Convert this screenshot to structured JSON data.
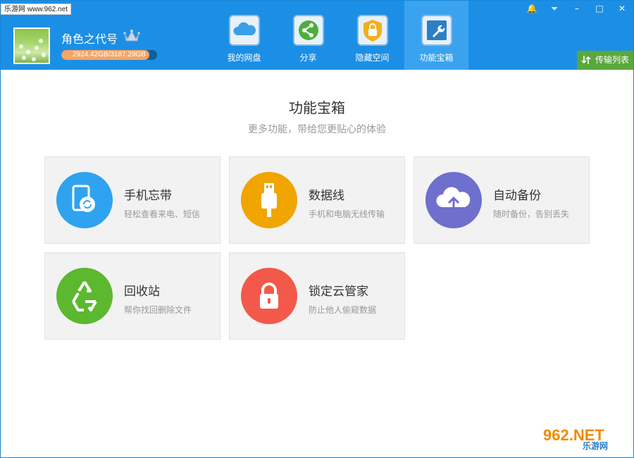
{
  "watermark_top": "乐游网 www.962.net",
  "user": {
    "name": "角色之代号",
    "quota": "2924.42GB/3187.29GB",
    "quota_used_fraction": 0.9175
  },
  "nav": [
    {
      "label": "我的网盘",
      "icon": "cloud-drive-icon",
      "active": false
    },
    {
      "label": "分享",
      "icon": "share-icon",
      "active": false
    },
    {
      "label": "隐藏空间",
      "icon": "lock-shield-icon",
      "active": false
    },
    {
      "label": "功能宝箱",
      "icon": "wrench-icon",
      "active": true
    }
  ],
  "window_controls": {
    "notify": "🔔",
    "menu": "⏷",
    "minimize": "–",
    "maximize": "□",
    "close": "✕"
  },
  "transfer_label": "传输列表",
  "page": {
    "title": "功能宝箱",
    "subtitle": "更多功能，带给您更贴心的体验"
  },
  "cards": [
    {
      "title": "手机忘带",
      "desc": "轻松查看来电、短信",
      "color": "#2fa3ef",
      "icon": "phone-sync-icon"
    },
    {
      "title": "数据线",
      "desc": "手机和电脑无线传输",
      "color": "#f0a500",
      "icon": "usb-cable-icon"
    },
    {
      "title": "自动备份",
      "desc": "随时备份，告别丢失",
      "color": "#6f6fcd",
      "icon": "cloud-upload-icon"
    },
    {
      "title": "回收站",
      "desc": "帮你找回删除文件",
      "color": "#5cb82f",
      "icon": "recycle-icon"
    },
    {
      "title": "锁定云管家",
      "desc": "防止他人偷窥数据",
      "color": "#f3594a",
      "icon": "padlock-icon"
    }
  ],
  "watermark_bottom": {
    "main": "962.NET",
    "sub": "乐游网"
  }
}
